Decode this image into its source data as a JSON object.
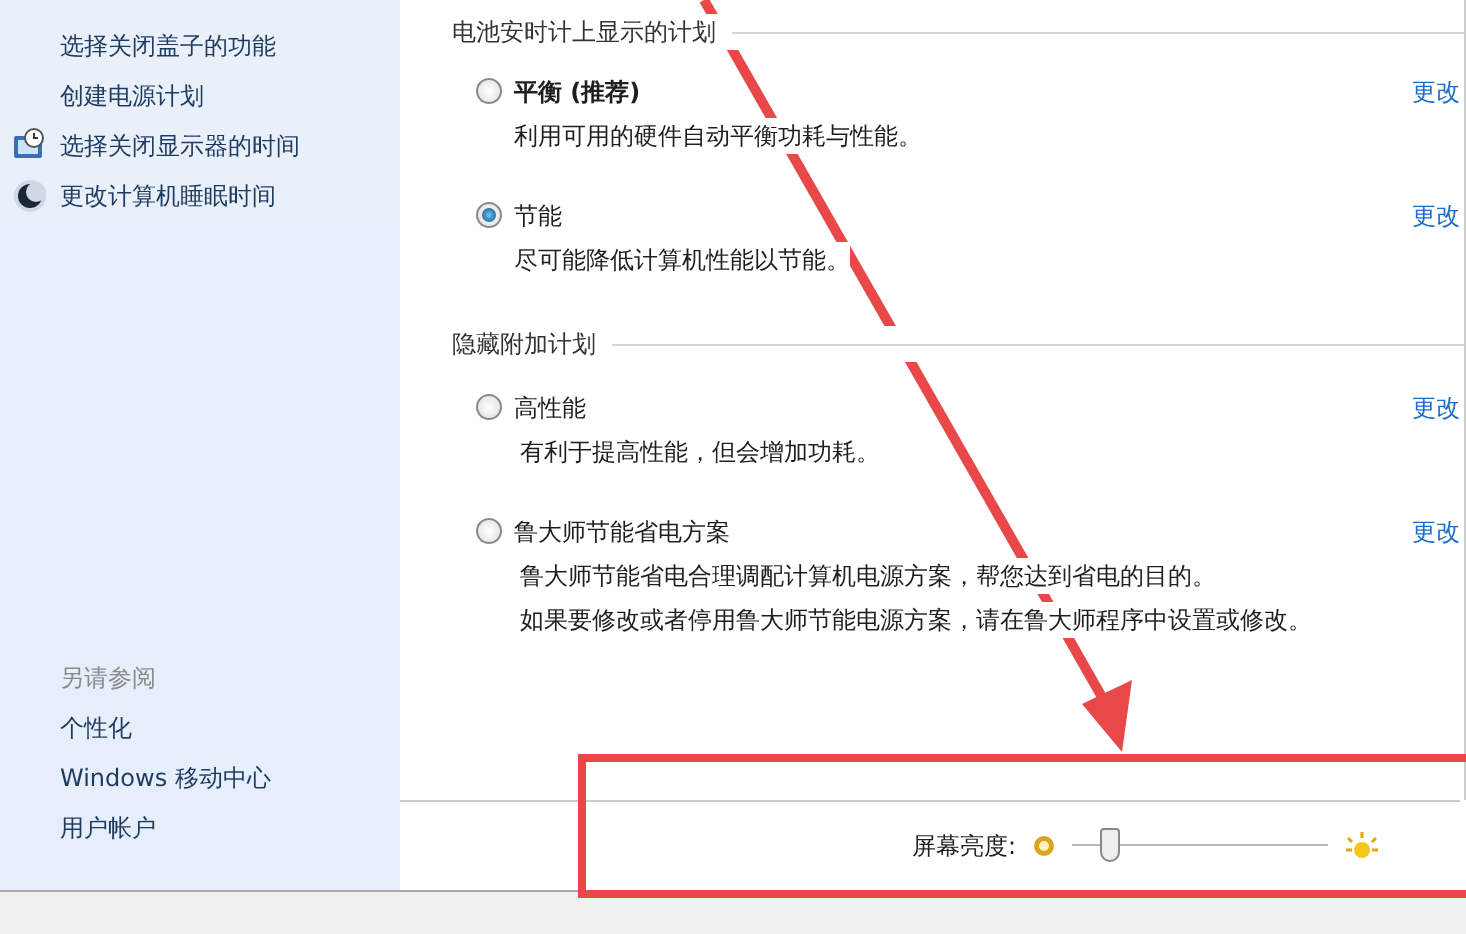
{
  "sidebar": {
    "tasks": [
      {
        "label": "选择关闭盖子的功能",
        "kind": "link"
      },
      {
        "label": "创建电源计划",
        "kind": "link"
      },
      {
        "label": "选择关闭显示器的时间",
        "kind": "display"
      },
      {
        "label": "更改计算机睡眠时间",
        "kind": "sleep"
      }
    ],
    "see_also": {
      "heading": "另请参阅",
      "items": [
        "个性化",
        "Windows 移动中心",
        "用户帐户"
      ]
    }
  },
  "plan_groups": [
    {
      "heading": "电池安时计上显示的计划",
      "plans": [
        {
          "name": "平衡 (推荐)",
          "kind": "recommended",
          "description": [
            "利用可用的硬件自动平衡功耗与性能。"
          ],
          "selected": false,
          "link": "更改"
        },
        {
          "name": "节能",
          "description": [
            "尽可能降低计算机性能以节能。"
          ],
          "selected": true,
          "link": "更改"
        }
      ]
    },
    {
      "heading": "隐藏附加计划",
      "plans": [
        {
          "name": "高性能",
          "description": [
            "有利于提高性能，但会增加功耗。"
          ],
          "selected": false,
          "link": "更改"
        },
        {
          "name": "鲁大师节能省电方案",
          "description": [
            "鲁大师节能省电合理调配计算机电源方案，帮您达到省电的目的。",
            "如果要修改或者停用鲁大师节能电源方案，请在鲁大师程序中设置或修改。"
          ],
          "selected": false,
          "link": "更改"
        }
      ]
    }
  ],
  "brightness": {
    "label": "屏幕亮度:",
    "level": 0.12
  }
}
